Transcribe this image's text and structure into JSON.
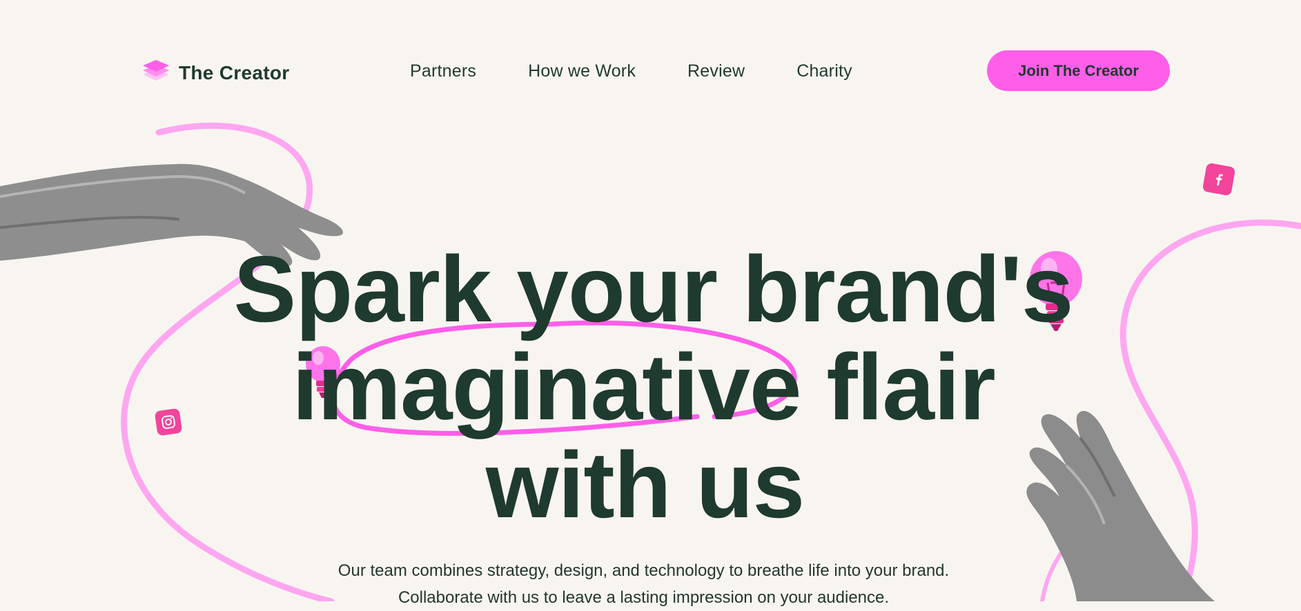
{
  "brand": {
    "name": "The Creator",
    "accent": "#ff5ee9",
    "text_color": "#1f3a2e",
    "background": "#f8f5f1"
  },
  "nav": {
    "items": [
      "Partners",
      "How we Work",
      "Review",
      "Charity"
    ]
  },
  "cta": {
    "label": "Join The Creator"
  },
  "hero": {
    "title_line1": "Spark your brand's",
    "title_line2": "imaginative flair",
    "title_line3": "with us",
    "subtitle": "Our team combines strategy, design, and technology to breathe life into your brand. Collaborate with us to leave a lasting impression on your audience."
  },
  "icons": {
    "logo": "layered-diamond-icon",
    "instagram": "instagram-icon",
    "facebook": "facebook-icon",
    "bulb": "lightbulb-icon"
  }
}
